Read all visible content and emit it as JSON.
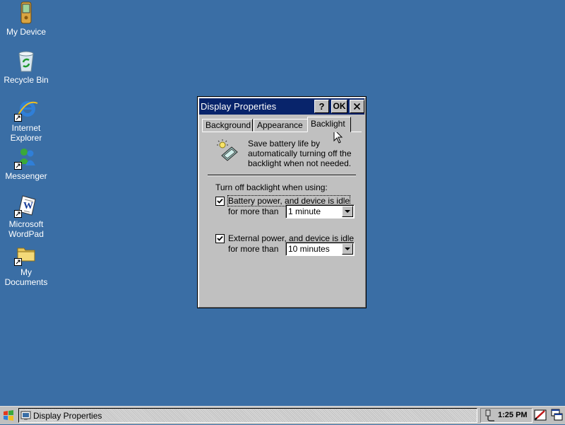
{
  "desktop": {
    "icons": [
      {
        "label": "My Device",
        "icon": "pda-device-icon"
      },
      {
        "label": "Recycle Bin",
        "icon": "recycle-bin-icon"
      },
      {
        "label": "Internet\nExplorer",
        "line1": "Internet",
        "line2": "Explorer",
        "icon": "internet-explorer-icon"
      },
      {
        "label": "Messenger",
        "icon": "messenger-icon"
      },
      {
        "line1": "Microsoft",
        "line2": "WordPad",
        "icon": "wordpad-icon"
      },
      {
        "line1": "My",
        "line2": "Documents",
        "icon": "folder-icon"
      }
    ],
    "background_color": "#3A6EA5"
  },
  "window": {
    "title": "Display Properties",
    "help_label": "?",
    "ok_label": "OK",
    "close_label": "✕",
    "tabs": [
      {
        "label": "Background",
        "active": false
      },
      {
        "label": "Appearance",
        "active": false
      },
      {
        "label": "Backlight",
        "active": true
      }
    ],
    "backlight": {
      "info_line1": "Save battery life by",
      "info_line2": "automatically turning off the",
      "info_line3": "backlight when not needed.",
      "group_label": "Turn off backlight when using:",
      "battery": {
        "checked": true,
        "label": "Battery power, and device is idle",
        "sub_label": "for more than",
        "value": "1 minute"
      },
      "external": {
        "checked": true,
        "label": "External power, and device is idle",
        "sub_label": "for more than",
        "value": "10 minutes"
      }
    }
  },
  "taskbar": {
    "task_label": "Display Properties",
    "clock": "1:25 PM"
  }
}
